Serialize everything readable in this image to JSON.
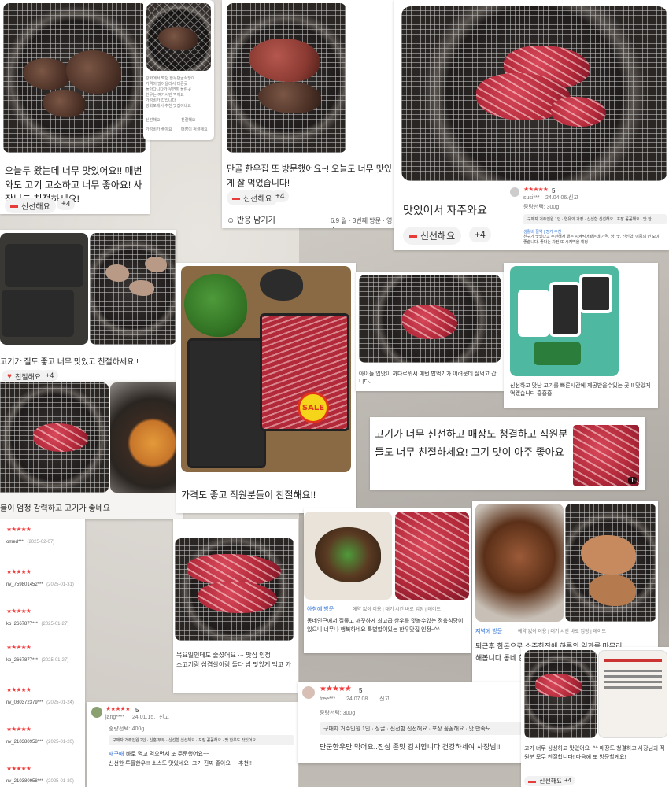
{
  "colors": {
    "accent_red": "#e63c3c",
    "star_red": "#f03c3c",
    "blue_link": "#2b6fd6"
  },
  "icons": {
    "fresh": "meat-icon",
    "react": "smile-icon"
  },
  "card1": {
    "text": "오늘두 왔는데 너무 맛있어요!! 매번 와도 고기 고소하고 너무 좋아요! 사장님도 친절하세요!",
    "chip": "신선해요",
    "more": "+4",
    "inner_lines": [
      "강화에서 먹던 한우단골식당이",
      "가격이 많이올라서 다른곳",
      "돌아다니다가 우연히 들린곳",
      "한우는 여기서만 먹어요",
      "가성비가 갑입니다",
      "강화포에서 추천 맛집이네요"
    ],
    "inner_tags": [
      "신선해요",
      "친절해요",
      "가성비가 좋아요",
      "매장이 청결해요"
    ]
  },
  "card2": {
    "text": "단골 한우집 또 방문했어요~! 오늘도 너무 맛있게 잘 먹었습니다!",
    "chip": "신선해요",
    "more": "+4",
    "react": "반응 남기기",
    "meta": "6.9 월 · 3번째 방문 · 영수"
  },
  "card3": {
    "text": "맛있어서 자주와요",
    "chip": "신선해요",
    "more": "+4",
    "stars": "★★★★★",
    "score": "5",
    "user": "susi***",
    "date": "24.04.06.",
    "report": "신고",
    "weight": "중량선택: 300g",
    "tagline": "구매자 거주인원 1인 · 연유의 가정 · 신선함 신선해요 · 포장 꼼꼼해요 · 맛 한",
    "badge": "생활비 절약 | 명가 추천",
    "body": "친구가 맛있다고 추천해서 했는 시켜먹어봤는데 가격, 양, 맛, 신선함, 이중의 면 모이 좋습니다. 좋다는 차전 또 시켜먹을 예정"
  },
  "card4": {
    "text": "고기가 질도 좋고 너무 맛있고 친절하세요 !",
    "chip": "친절해요",
    "more": "+4"
  },
  "card5": {
    "text": "가격도 좋고 직원분들이 친절해요!!",
    "sale": "SALE"
  },
  "card6": {
    "text": "아이들 입맛이 까다로워서 매번 밥먹기가 어려운데 잘먹고 갑니다."
  },
  "card7": {
    "text": "신선하고 맛난 고기를 빠른시간에 제공받을수있는 곳!!! 맛있게 먹겠습니다 홍홍홍"
  },
  "card8": {
    "text": "고기가 너무 신선하고 매장도 청결하고 직원분들도 너무 친절하세요! 고기 맛이 아주 좋아요",
    "count": "1"
  },
  "card9": {
    "text": "불이 엄청 강력하고 고기가 좋네요"
  },
  "reviews": [
    {
      "stars": "★★★★★",
      "name": "omed***",
      "date": "(2025-02-07)"
    },
    {
      "stars": "★★★★★",
      "name": "nv_759801452***",
      "date": "(2025-01-31)"
    },
    {
      "stars": "★★★★★",
      "name": "ko_2667877***",
      "date": "(2025-01-27)"
    },
    {
      "stars": "★★★★★",
      "name": "ko_2667877***",
      "date": "(2025-01-27)"
    },
    {
      "stars": "★★★★★",
      "name": "nv_080372379***",
      "date": "(2025-01-24)"
    },
    {
      "stars": "★★★★★",
      "name": "nv_210380958***",
      "date": "(2025-01-20)"
    },
    {
      "stars": "★★★★★",
      "name": "nv_210380958***",
      "date": "(2025-01-20)"
    }
  ],
  "card10": {
    "stars": "★★★★★",
    "score": "5",
    "user": "jang****",
    "date": "24.01.15.",
    "report": "신고",
    "weight": "중량선택: 400g",
    "tagline": "구매자 거주인원 2인 · 신혼/부부 · 신선함 신선해요 · 포장 꼼꼼해요 · 맛 한우도 맛있어요",
    "badge": "재구매",
    "body1": "바로 먹고 먹으면서 또 주문했어요~~",
    "body2": "신선한 투플한우!!! 소스도 맛있네요~고기 진짜 좋아요~~ 추천!!"
  },
  "card11": {
    "text1": "목요일인데도 줄섰어요 ··· 맛집 인정",
    "text2": "소고기랑 삼겹살이랑 둘다 넘 맛있게 먹고 가"
  },
  "card12": {
    "visit": "아침에 방문",
    "info": "예약 없이 이용 | 대기 시간 바로 입장 | 데이트",
    "text": "동네인근에서 질좋고 깨끗하게 최고급 한우를 맛볼수있는 정육식당이 있으니 너무나 행복하네요 특별할이있는 한우맛집 인정~^^"
  },
  "card13": {
    "visit": "저녁에 방문",
    "info": "예약 없이 이용 | 대기 시간 바로 입장 | 데이트",
    "text": "퇴근후 한돈으로 소주한잔에 하루의 일과를 마무리해봅니다 동네 한돈맛 특히나 여자사"
  },
  "card14": {
    "stars": "★★★★★",
    "score": "5",
    "user": "free***",
    "date": "24.07.08.",
    "report": "신고",
    "weight": "중량선택: 300g",
    "tagline": "구매자 거주인원 1인 · 싱글 · 신선함 신선해요 · 포장 꼼꼼해요 · 맛 만족도",
    "body": "단군한우만 먹어요..진심 존맛 감사합니다 건강하세여 사장님!!"
  },
  "card15": {
    "text": "고기 너무 싱싱하고 맛있어요~^^ 매장도 청결하고 사장님과 직원분 모두 친절합니다! 다음에 또 방문할게요!",
    "chip": "신선해요",
    "more": "+4"
  }
}
